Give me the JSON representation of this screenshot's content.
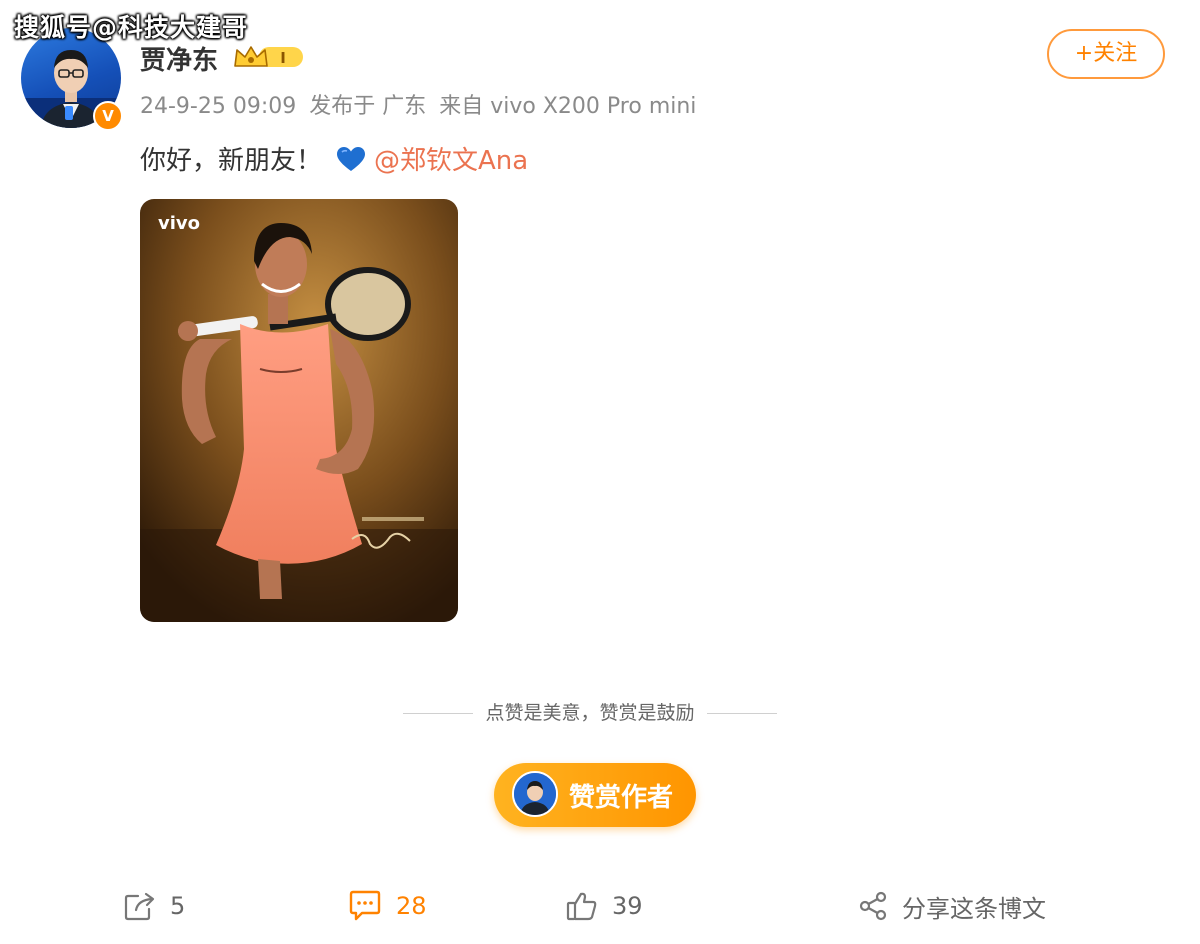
{
  "watermark": "搜狐号@科技大建哥",
  "post": {
    "author": "贾净东",
    "level_badge_text": "I",
    "verified_badge": "V",
    "follow_label": "+关注",
    "meta": {
      "datetime": "24-9-25 09:09",
      "location": "发布于 广东",
      "source": "来自 vivo X200 Pro mini"
    },
    "text": "你好，新朋友！",
    "mention": "@郑钦文Ana",
    "image": {
      "brand": "vivo"
    }
  },
  "reward": {
    "hint": "点赞是美意，赞赏是鼓励",
    "button_label": "赞赏作者"
  },
  "actions": {
    "repost_count": "5",
    "comment_count": "28",
    "like_count": "39",
    "share_label": "分享这条博文"
  },
  "icons": {
    "repost": "repost-icon",
    "comment": "comment-icon",
    "like": "thumbs-up-icon",
    "share": "share-icon",
    "heart": "blue-heart-icon",
    "crown": "crown-icon"
  },
  "colors": {
    "accent": "#ff8200",
    "mention": "#eb7350",
    "meta": "#8a8a8a",
    "heart": "#1f6fd1"
  }
}
